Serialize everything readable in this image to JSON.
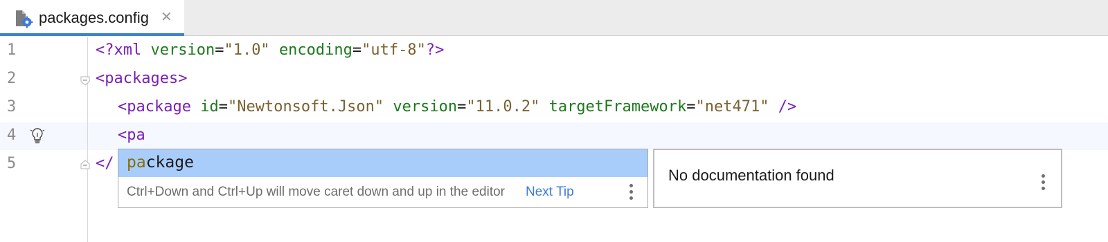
{
  "tab": {
    "file_name": "packages.config",
    "close_glyph": "✕",
    "icon": "config-file-gear-icon"
  },
  "gutter": {
    "line_numbers": [
      "1",
      "2",
      "3",
      "4",
      "5"
    ]
  },
  "code": {
    "line1": {
      "open": "<?xml",
      "attr1": "version",
      "eq1": "=",
      "val1": "\"1.0\"",
      "attr2": "encoding",
      "eq2": "=",
      "val2": "\"utf-8\"",
      "close": "?>"
    },
    "line2": {
      "tag": "<packages>"
    },
    "line3": {
      "open": "<package",
      "attr1": "id",
      "eq1": "=",
      "val1": "\"Newtonsoft.Json\"",
      "attr2": "version",
      "eq2": "=",
      "val2": "\"11.0.2\"",
      "attr3": "targetFramework",
      "eq3": "=",
      "val3": "\"net471\"",
      "close": "/>"
    },
    "line4": {
      "typed": "<pa"
    },
    "line5": {
      "partial": "</"
    }
  },
  "completion": {
    "item_match": "pa",
    "item_rest": "ckage",
    "tip_text": "Ctrl+Down and Ctrl+Up will move caret down and up in the editor",
    "next_tip_label": "Next Tip"
  },
  "documentation": {
    "text": "No documentation found"
  },
  "colors": {
    "tag": "#7a1fb8",
    "attribute": "#1c7a1c",
    "string": "#7a6231",
    "selection": "#a9cdfb",
    "link": "#3d7bd6",
    "tab_underline": "#4083c9"
  }
}
